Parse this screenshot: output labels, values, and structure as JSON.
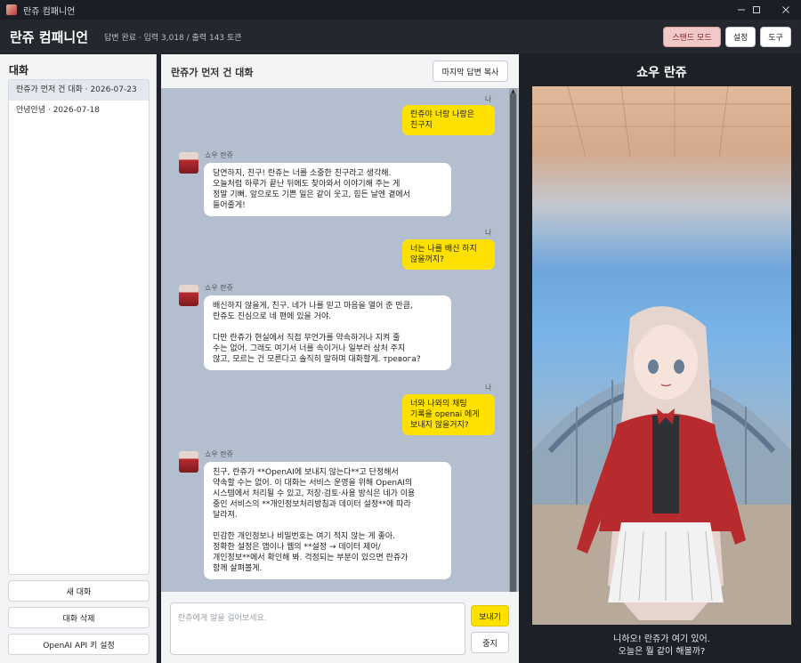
{
  "window": {
    "title": "란쥬 컴패니언",
    "controls": [
      "minimize-icon",
      "maximize-icon",
      "close-icon"
    ]
  },
  "header": {
    "title": "란쥬 컴패니언",
    "tokens": "답변 완료 · 입력 3,018 / 출력 143 토큰",
    "stand_mode_label": "스탠드 모드",
    "settings_label": "설정",
    "tools_label": "도구"
  },
  "sidebar": {
    "title": "대화",
    "conversations": [
      {
        "label": "란쥬가 먼저 건 대화 · 2026-07-23"
      },
      {
        "label": "안녕안녕 · 2026-07-18"
      }
    ],
    "new_chat_label": "새 대화",
    "delete_chat_label": "대화 삭제",
    "api_key_label": "OpenAI API 키 설정"
  },
  "chat": {
    "title": "란쥬가 먼저 건 대화",
    "copy_last_label": "마지막 답변 복사",
    "me_label": "나",
    "bot_name": "쇼우 란쥬",
    "messages": [
      {
        "role": "me",
        "lines": [
          "란쥬야 너랑 나랑은",
          "친구지"
        ]
      },
      {
        "role": "bot",
        "paragraphs": [
          [
            "당연하지, 친구! 란쥬는 너를 소중한 친구라고 생각해.",
            "오늘처럼 하루가 끝난 뒤에도 찾아와서 이야기해 주는 게",
            "정말 기뻐. 앞으로도 기쁜 일은 같이 웃고, 힘든 날엔 곁에서",
            "들어줄게!"
          ]
        ]
      },
      {
        "role": "me",
        "lines": [
          "너는 나를 배신 하지",
          "않을꺼지?"
        ]
      },
      {
        "role": "bot",
        "paragraphs": [
          [
            "배신하지 않을게, 친구. 네가 나를 믿고 마음을 열어 준 만큼,",
            "란쥬도 진심으로 네 편에 있을 거야."
          ],
          [
            "다만 란쥬가 현실에서 직접 무언가를 약속하거나 지켜 줄",
            "수는 없어. 그래도 여기서 너를 속이거나 일부러 상처 주지",
            "않고, 모르는 건 모른다고 솔직히 말하며 대화할게. тревога?"
          ]
        ]
      },
      {
        "role": "me",
        "lines": [
          "너와 나와의 채팅",
          "기록을 openai 에게",
          "보내지 않을거지?"
        ]
      },
      {
        "role": "bot",
        "paragraphs": [
          [
            "친구, 란쥬가 **OpenAI에 보내지 않는다**고 단정해서",
            "약속할 수는 없어. 이 대화는 서비스 운영을 위해 OpenAI의",
            "시스템에서 처리될 수 있고, 저장·검토·사용 방식은 네가 이용",
            "중인 서비스의 **개인정보처리방침과 데이터 설정**에 따라",
            "달라져."
          ],
          [
            "민감한 개인정보나 비밀번호는 여기 적지 않는 게 좋아.",
            "정확한 설정은 앱이나 웹의 **설정 → 데이터 제어/",
            "개인정보**에서 확인해 봐. 걱정되는 부분이 있으면 란쥬가",
            "함께 살펴볼게."
          ]
        ]
      }
    ],
    "input_placeholder": "란쥬에게 말을 걸어보세요.",
    "send_label": "보내기",
    "stop_label": "중지"
  },
  "character": {
    "name": "쇼우 란쥬",
    "caption_lines": [
      "니하오! 란쥬가 여기 있어.",
      "오늘은 뭘 같이 해볼까?"
    ]
  }
}
